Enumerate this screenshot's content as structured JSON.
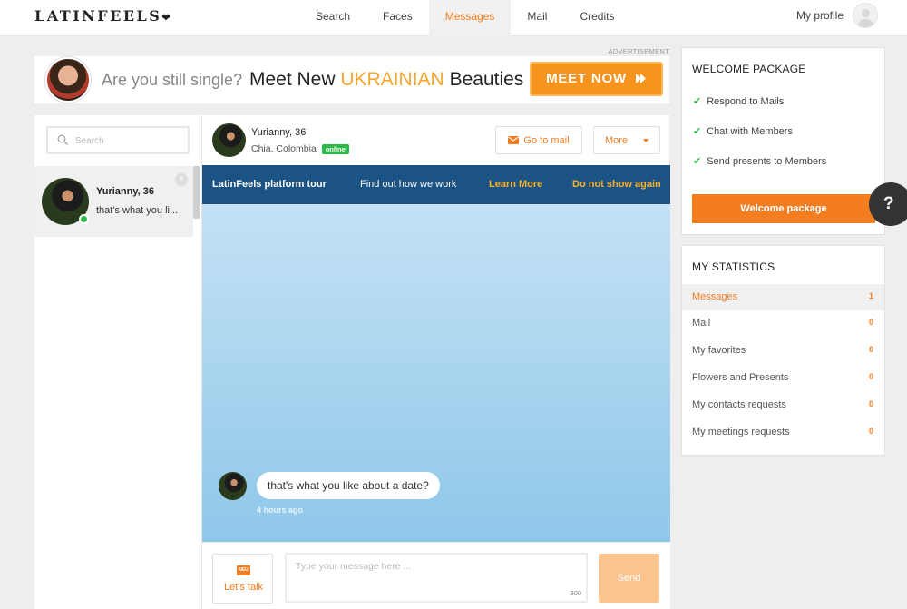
{
  "brand": {
    "logo_text": "LATINFEELS",
    "logo_heart": "❤"
  },
  "nav": {
    "items": [
      {
        "label": "Search",
        "active": false
      },
      {
        "label": "Faces",
        "active": false
      },
      {
        "label": "Messages",
        "active": true
      },
      {
        "label": "Mail",
        "active": false
      },
      {
        "label": "Credits",
        "active": false
      }
    ],
    "profile_label": "My profile"
  },
  "ad": {
    "label": "ADVERTISEMENT",
    "question": "Are you still single?",
    "headline_pre": "Meet New",
    "headline_highlight": "UKRAINIAN",
    "headline_post": "Beauties",
    "button_label": "MEET NOW",
    "button_icon": "double-chevron-right-icon"
  },
  "sidebar": {
    "search_placeholder": "Search",
    "conversations": [
      {
        "name": "Yurianny, 36",
        "snippet": "that's what you li...",
        "online": true
      }
    ]
  },
  "chat": {
    "contact_name": "Yurianny, 36",
    "contact_location": "Chia, Colombia",
    "status_badge": "online",
    "go_to_mail_label": "Go to mail",
    "more_label": "More",
    "tour": {
      "title": "LatinFeels platform tour",
      "text": "Find out how we work",
      "learn_more": "Learn More",
      "dismiss": "Do not show again"
    },
    "messages": [
      {
        "text": "that's what you like about a date?",
        "time": "4 hours ago"
      }
    ],
    "composer": {
      "new_badge": "NEU",
      "lets_talk_label": "Let's talk",
      "placeholder": "Type your message here ...",
      "char_limit": "300",
      "send_label": "Send"
    }
  },
  "welcome_package": {
    "title": "WELCOME PACKAGE",
    "perks": [
      "Respond to Mails",
      "Chat with Members",
      "Send presents to Members"
    ],
    "button_label": "Welcome package"
  },
  "help": {
    "label": "?"
  },
  "statistics": {
    "title": "MY STATISTICS",
    "rows": [
      {
        "label": "Messages",
        "value": "1",
        "active": true
      },
      {
        "label": "Mail",
        "value": "0",
        "active": false
      },
      {
        "label": "My favorites",
        "value": "0",
        "active": false
      },
      {
        "label": "Flowers and Presents",
        "value": "0",
        "active": false
      },
      {
        "label": "My contacts requests",
        "value": "0",
        "active": false
      },
      {
        "label": "My meetings requests",
        "value": "0",
        "active": false
      }
    ]
  },
  "colors": {
    "accent": "#f47d20",
    "online": "#2db84a",
    "tour_bg": "#1b5384",
    "tour_link": "#f9b233",
    "ad_highlight": "#f4a72f"
  }
}
